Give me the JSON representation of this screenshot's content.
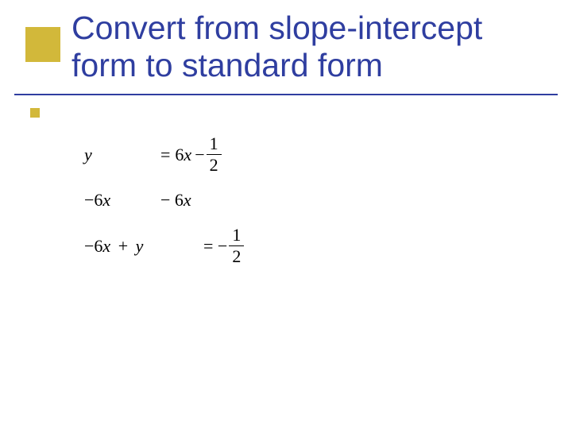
{
  "title": "Convert from slope-intercept form to standard form",
  "math": {
    "row1": {
      "lhs": "y",
      "eq": "=",
      "term1": "6x",
      "minus": "−",
      "frac_num": "1",
      "frac_den": "2"
    },
    "row2": {
      "lhs": "−6x",
      "rhs": "− 6x"
    },
    "row3": {
      "lhs_a": "−6x",
      "plus": "+",
      "lhs_b": "y",
      "eq": "= −",
      "frac_num": "1",
      "frac_den": "2"
    }
  }
}
